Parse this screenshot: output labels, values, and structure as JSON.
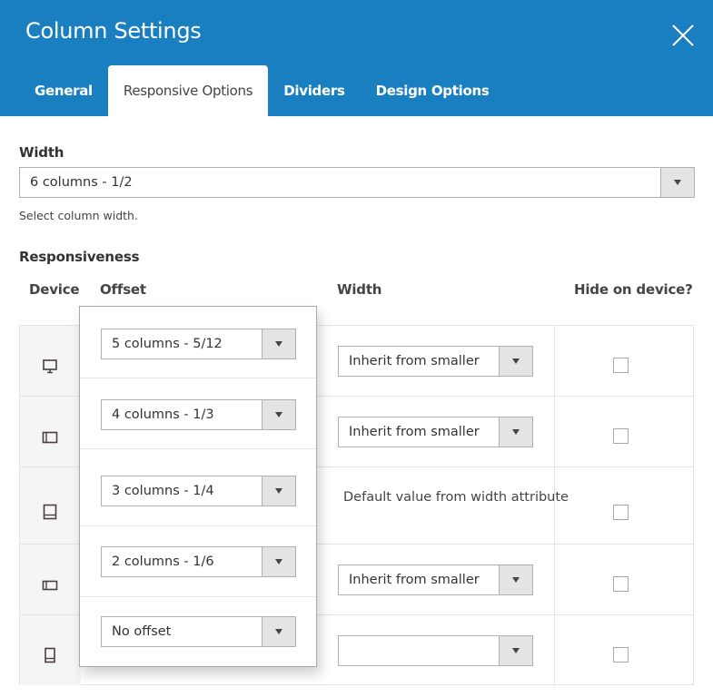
{
  "dialog": {
    "title": "Column Settings",
    "close_icon": "close-icon"
  },
  "tabs": [
    {
      "label": "General",
      "active": false
    },
    {
      "label": "Responsive Options",
      "active": true
    },
    {
      "label": "Dividers",
      "active": false
    },
    {
      "label": "Design Options",
      "active": false
    }
  ],
  "width_field": {
    "label": "Width",
    "value": "6 columns - 1/2",
    "help": "Select column width."
  },
  "responsiveness": {
    "label": "Responsiveness",
    "columns": {
      "device": "Device",
      "offset": "Offset",
      "width": "Width",
      "hide": "Hide on device?"
    },
    "rows": [
      {
        "device": "desktop",
        "device_icon": "desktop-icon",
        "offset": "5 columns - 5/12",
        "width": "Inherit from smaller",
        "width_note": null,
        "hide": false
      },
      {
        "device": "tablet-landscape",
        "device_icon": "tablet-landscape-icon",
        "offset": "4 columns - 1/3",
        "width": "Inherit from smaller",
        "width_note": null,
        "hide": false
      },
      {
        "device": "tablet-portrait",
        "device_icon": "tablet-portrait-icon",
        "offset": "3 columns - 1/4",
        "width": null,
        "width_note": "Default value from width attribute",
        "hide": false
      },
      {
        "device": "mobile-landscape",
        "device_icon": "mobile-landscape-icon",
        "offset": "2 columns - 1/6",
        "width": "Inherit from smaller",
        "width_note": null,
        "hide": false
      },
      {
        "device": "mobile-portrait",
        "device_icon": "mobile-portrait-icon",
        "offset": "No offset",
        "width": "",
        "width_note": null,
        "hide": false
      }
    ]
  },
  "colors": {
    "header": "#1a7fc1",
    "select_arrow_bg": "#e4e4e4",
    "device_cell_bg": "#f5f5f5"
  }
}
